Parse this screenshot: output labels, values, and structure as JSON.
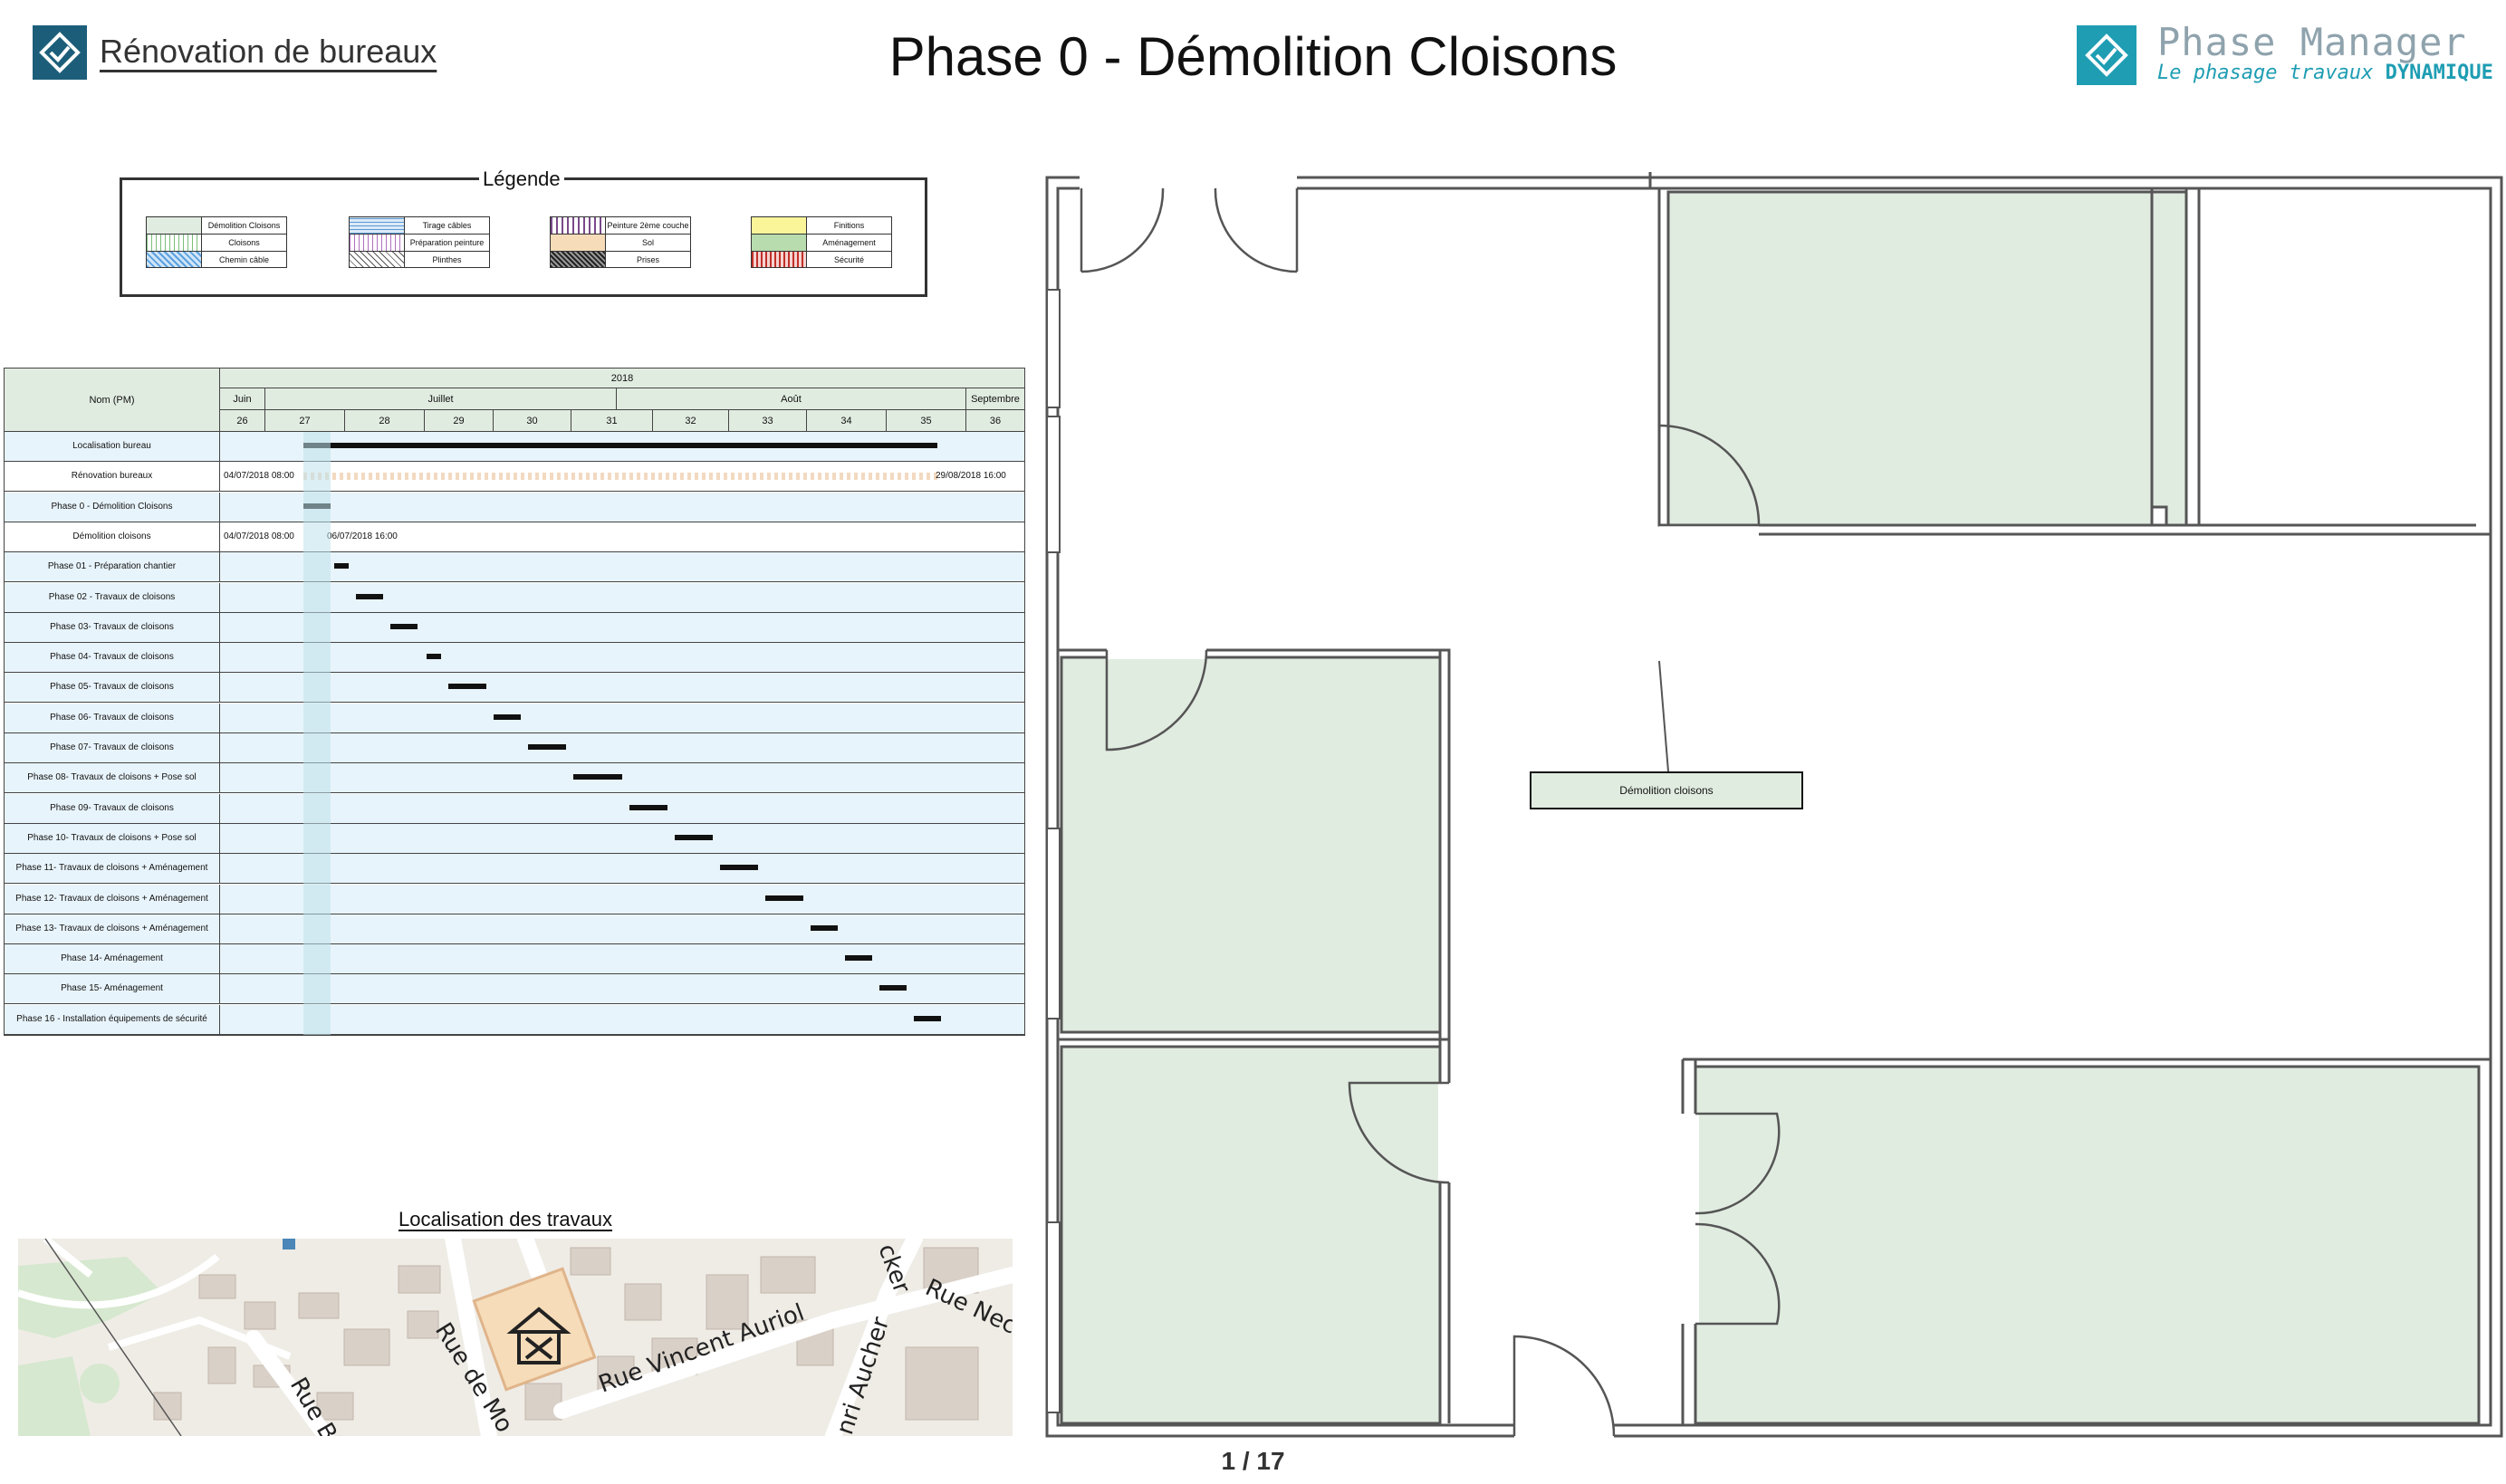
{
  "header": {
    "project_title": "Rénovation de bureaux",
    "page_title": "Phase 0 - Démolition Cloisons",
    "brand_name": "Phase Manager",
    "brand_tagline": "Le phasage travaux ",
    "brand_tagline_strong": "DYNAMIQUE"
  },
  "legend": {
    "title": "Légende",
    "groups": [
      [
        "Démolition Cloisons",
        "Cloisons",
        "Chemin câble"
      ],
      [
        "Tirage câbles",
        "Préparation peinture",
        "Plinthes"
      ],
      [
        "Peinture 2ème couche",
        "Sol",
        "Prises"
      ],
      [
        "Finitions",
        "Aménagement",
        "Sécurité"
      ]
    ]
  },
  "gantt": {
    "name_header": "Nom (PM)",
    "year": "2018",
    "months": [
      "Juin",
      "Juillet",
      "Août",
      "Septembre"
    ],
    "weeks": [
      "26",
      "27",
      "28",
      "29",
      "30",
      "31",
      "32",
      "33",
      "34",
      "35",
      "36"
    ],
    "rows": [
      "Localisation bureau",
      "Rénovation bureaux",
      "Phase 0 - Démolition Cloisons",
      "Démolition cloisons",
      "Phase 01 - Préparation chantier",
      "Phase 02 - Travaux de cloisons",
      "Phase 03- Travaux de cloisons",
      "Phase 04- Travaux de cloisons",
      "Phase 05- Travaux de cloisons",
      "Phase 06- Travaux de cloisons",
      "Phase 07- Travaux de cloisons",
      "Phase 08- Travaux de cloisons + Pose sol",
      "Phase 09- Travaux de cloisons",
      "Phase 10- Travaux de cloisons + Pose sol",
      "Phase 11- Travaux de cloisons + Aménagement",
      "Phase 12- Travaux de cloisons + Aménagement",
      "Phase 13- Travaux de cloisons + Aménagement",
      "Phase 14- Aménagement",
      "Phase 15- Aménagement",
      "Phase 16 - Installation équipements de sécurité"
    ],
    "dates": {
      "reno_start": "04/07/2018 08:00",
      "reno_end": "29/08/2018 16:00",
      "demo_start": "04/07/2018 08:00",
      "demo_end": "06/07/2018 16:00"
    }
  },
  "location": {
    "title": "Localisation des travaux",
    "streets": [
      "Rue de Mo",
      "Rue Vincent Auriol",
      "Rue Neck",
      "nri Aucher",
      "cker",
      "Rue Bi"
    ]
  },
  "plan": {
    "label": "Démolition cloisons"
  },
  "pagination": "1 / 17",
  "colors": {
    "room_fill": "#e1ece1",
    "gantt_row": "#e8f4fb",
    "brand": "#1e9db3",
    "project_logo": "#1c5e7a"
  }
}
